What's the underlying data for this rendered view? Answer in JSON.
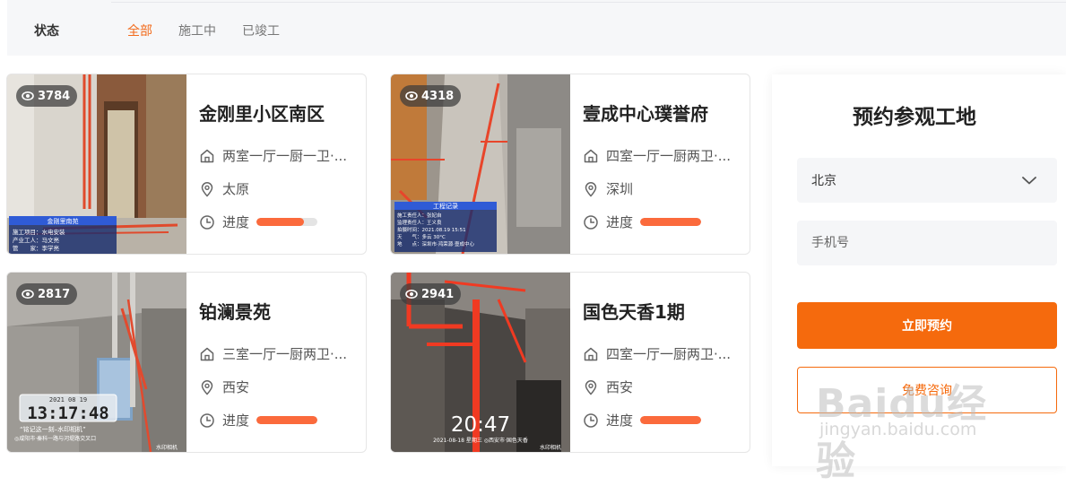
{
  "filter": {
    "label": "状态",
    "options": [
      {
        "label": "全部",
        "active": true
      },
      {
        "label": "施工中",
        "active": false
      },
      {
        "label": "已竣工",
        "active": false
      }
    ]
  },
  "cards": [
    {
      "views": "3784",
      "title": "金刚里小区南区",
      "layout": "两室一厅一厨一卫·...",
      "city": "太原",
      "progress_label": "进度",
      "progress": 0.78,
      "photo_caption": "金刚里南苑",
      "photo_lines": [
        "施工项目：水电安装",
        "产业工人：马文亮",
        "管　　家：李学亮"
      ]
    },
    {
      "views": "4318",
      "title": "壹成中心璞誉府",
      "layout": "四室一厅一厨两卫·...",
      "city": "深圳",
      "progress_label": "进度",
      "progress": 1.0,
      "photo_caption": "工程记录",
      "photo_lines": [
        "施工责任人：张妃自",
        "监理责任人：王义良",
        "拍摄时间：2021.08.19 15:51",
        "天　　气：多云 30°C",
        "地　　点：深圳市·鸿荣源·壹成中心"
      ]
    },
    {
      "views": "2817",
      "title": "铂澜景苑",
      "layout": "三室一厅一厨两卫·...",
      "city": "西安",
      "progress_label": "进度",
      "progress": 1.0,
      "photo_date": "2021 08 19",
      "photo_time": "13:17:48",
      "photo_lines": [
        "“铭记这一刻–水印相机”",
        "◎咸阳市·秦科一路与河堤路交叉口"
      ],
      "photo_brand": "水印相机"
    },
    {
      "views": "2941",
      "title": "国色天香1期",
      "layout": "四室一厅一厨两卫·...",
      "city": "西安",
      "progress_label": "进度",
      "progress": 1.0,
      "photo_time": "20:47",
      "photo_lines": [
        "2021-08-18 星期三 ◎西安市·国色天香"
      ],
      "photo_brand": "水印相机"
    }
  ],
  "booking": {
    "title": "预约参观工地",
    "city_value": "北京",
    "phone_placeholder": "手机号",
    "submit_label": "立即预约",
    "secondary_label": "免费咨询"
  },
  "watermark": {
    "brand": "Baidu经验",
    "url": "jingyan.baidu.com"
  },
  "colors": {
    "accent": "#f56a0d",
    "progress": "#fb6a3c",
    "filter_active": "#f26a1b"
  }
}
